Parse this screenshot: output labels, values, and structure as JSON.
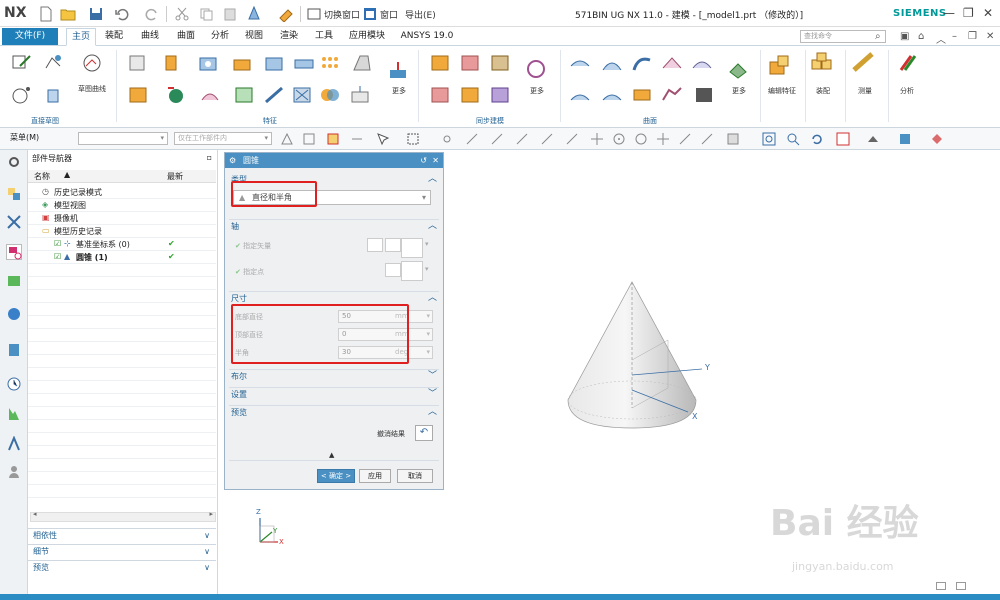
{
  "app": {
    "logo": "NX",
    "title": "571BIN UG NX 11.0 - 建模 - [_model1.prt （修改的）]",
    "brand": "SIEMENS",
    "switch_window": "切换窗口",
    "window": "窗口",
    "export": "导出(E)"
  },
  "tabs": {
    "file": "文件(F)",
    "items": [
      "主页",
      "装配",
      "曲线",
      "曲面",
      "分析",
      "视图",
      "渲染",
      "工具",
      "应用模块",
      "ANSYS 19.0"
    ],
    "active": "主页",
    "search_placeholder": "查找命令"
  },
  "ribbon": {
    "sketch_curve": "草图曲线",
    "direct_sketch": "直接草图",
    "feature": "特征",
    "sync_modeling": "同步建模",
    "surface": "曲面",
    "more": "更多",
    "edit_feature": "编辑特征",
    "assembly": "装配",
    "measure": "测量",
    "analysis": "分析"
  },
  "toolbar": {
    "menu": "菜单(M)",
    "filter_placeholder": "",
    "scope": "仅在工作部件内"
  },
  "navigator": {
    "title": "部件导航器",
    "col_name": "名称",
    "col_latest": "最新",
    "rows": [
      {
        "label": "历史记录模式",
        "indent": 0,
        "check": ""
      },
      {
        "label": "模型视图",
        "indent": 0,
        "check": ""
      },
      {
        "label": "摄像机",
        "indent": 0,
        "check": ""
      },
      {
        "label": "模型历史记录",
        "indent": 0,
        "check": ""
      },
      {
        "label": "基准坐标系 (0)",
        "indent": 1,
        "check": "✔"
      },
      {
        "label": "圆锥 (1)",
        "indent": 1,
        "check": "✔"
      }
    ],
    "panels": [
      "相依性",
      "细节",
      "预览"
    ]
  },
  "dialog": {
    "title": "圆锥",
    "type_section": "类型",
    "type_value": "直径和半角",
    "axis_section": "轴",
    "specify_vector": "指定矢量",
    "specify_point": "指定点",
    "dims_section": "尺寸",
    "dims": [
      {
        "label": "底部直径",
        "value": "50",
        "unit": "mm"
      },
      {
        "label": "顶部直径",
        "value": "0",
        "unit": "mm"
      },
      {
        "label": "半角",
        "value": "30",
        "unit": "deg"
      }
    ],
    "boolean_section": "布尔",
    "settings_section": "设置",
    "preview_section": "预览",
    "undo_result": "撤消结果",
    "ok": "< 确定 >",
    "apply": "应用",
    "cancel": "取消"
  },
  "graphics": {
    "axis_y": "Y",
    "axis_x": "X",
    "triad_z": "Z",
    "triad_x": "X",
    "triad_y": "Y"
  },
  "watermark": {
    "main": "Bai 经验",
    "sub": "jingyan.baidu.com"
  },
  "colors": {
    "accent": "#1f7fb8",
    "dialog_title": "#4a90c2",
    "highlight": "#e02020",
    "check": "#2aa52a"
  }
}
